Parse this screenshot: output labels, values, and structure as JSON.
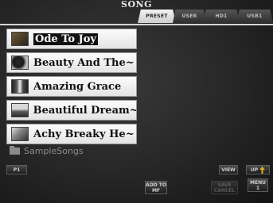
{
  "title": "SONG",
  "tabs": [
    {
      "label": "PRESET",
      "active": true
    },
    {
      "label": "USER",
      "active": false
    },
    {
      "label": "HD1",
      "active": false
    },
    {
      "label": "USB1",
      "active": false
    }
  ],
  "songs": [
    {
      "name": "Ode To Joy",
      "selected": true
    },
    {
      "name": "Beauty And The~",
      "selected": false
    },
    {
      "name": "Amazing Grace",
      "selected": false
    },
    {
      "name": "Beautiful Dream~",
      "selected": false
    },
    {
      "name": "Achy Breaky He~",
      "selected": false
    }
  ],
  "folder": {
    "name": "SampleSongs",
    "icon": "folder-icon"
  },
  "buttons": {
    "page": "P1",
    "view": "VIEW",
    "up": "UP",
    "add_to_mf_line1": "ADD TO",
    "add_to_mf_line2": "MF",
    "save": "SAVE",
    "cancel": "CANCEL",
    "menu_line1": "MENU",
    "menu_line2": "1"
  },
  "colors": {
    "accent": "#e0b020",
    "selected_bg": "#111111"
  }
}
